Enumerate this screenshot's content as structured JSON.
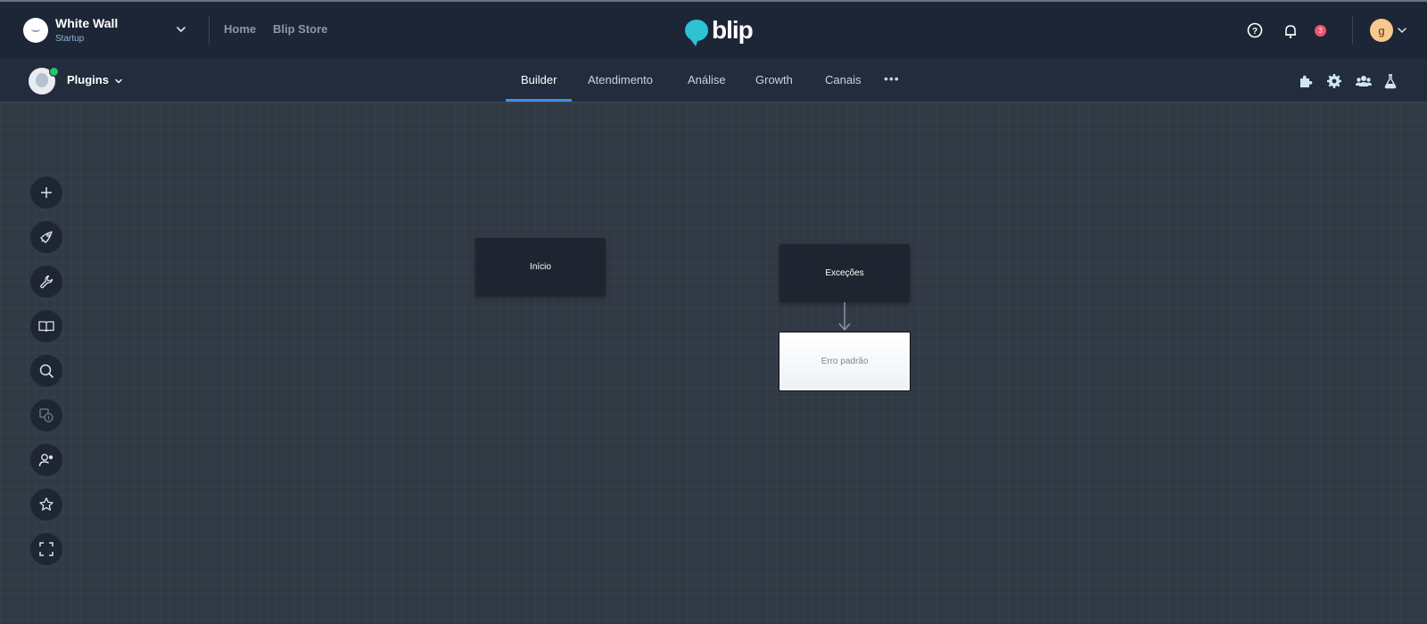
{
  "org": {
    "name": "White Wall",
    "plan": "Startup"
  },
  "top_nav": {
    "home": "Home",
    "store": "Blip Store"
  },
  "brand": {
    "text": "blip",
    "accent": "#2cc3d5"
  },
  "notifications": {
    "count": "3"
  },
  "user": {
    "initial": "g"
  },
  "bot": {
    "name": "Plugins"
  },
  "tabs": [
    {
      "label": "Builder"
    },
    {
      "label": "Atendimento"
    },
    {
      "label": "Análise"
    },
    {
      "label": "Growth"
    },
    {
      "label": "Canais"
    }
  ],
  "tabs_more": "•••",
  "header_tools": [
    "puzzle-icon",
    "gear-icon",
    "users-icon",
    "flask-icon"
  ],
  "canvas_tools": [
    "plus-icon",
    "rocket-icon",
    "wrench-icon",
    "book-icon",
    "search-icon",
    "resources-icon",
    "user-settings-icon",
    "star-icon",
    "fullscreen-icon"
  ],
  "blocks": {
    "start": "Início",
    "exceptions": "Exceções",
    "default_error": "Erro padrão"
  },
  "colors": {
    "topbar": "#1c2636",
    "navbar": "#222c3c",
    "canvas": "#313945",
    "active_tab": "#3f8fe8",
    "badge": "#f4526c",
    "online": "#22c56c"
  }
}
